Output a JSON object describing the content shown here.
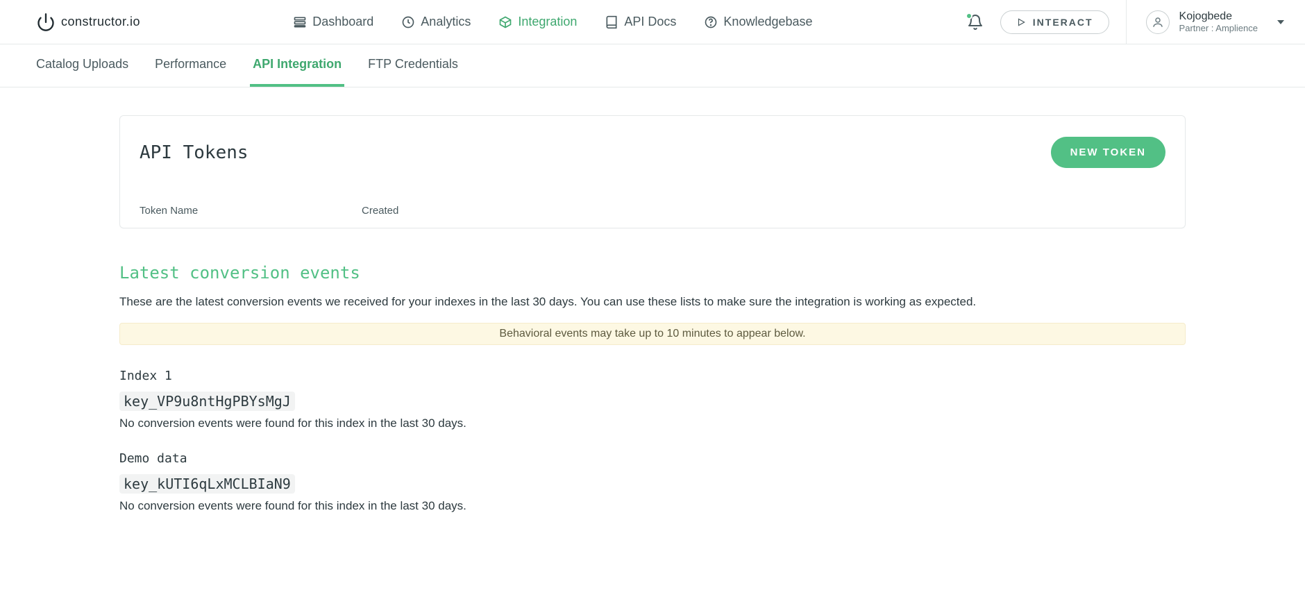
{
  "brand": {
    "wordmark": "constructor.io"
  },
  "nav": {
    "dashboard": "Dashboard",
    "analytics": "Analytics",
    "integration": "Integration",
    "api_docs": "API Docs",
    "knowledgebase": "Knowledgebase"
  },
  "interact_button": "INTERACT",
  "user": {
    "name": "Kojogbede",
    "subtitle": "Partner : Amplience"
  },
  "subnav": {
    "catalog_uploads": "Catalog Uploads",
    "performance": "Performance",
    "api_integration": "API Integration",
    "ftp_credentials": "FTP Credentials"
  },
  "tokens_card": {
    "title": "API Tokens",
    "new_button": "NEW TOKEN",
    "col_name": "Token Name",
    "col_created": "Created"
  },
  "events_section": {
    "title": "Latest conversion events",
    "description": "These are the latest conversion events we received for your indexes in the last 30 days. You can use these lists to make sure the integration is working as expected.",
    "behavior_note": "Behavioral events may take up to 10 minutes to appear below."
  },
  "indexes": {
    "0": {
      "name": "Index 1",
      "key": "key_VP9u8ntHgPBYsMgJ",
      "empty_msg": "No conversion events were found for this index in the last 30 days."
    },
    "1": {
      "name": "Demo data",
      "key": "key_kUTI6qLxMCLBIaN9",
      "empty_msg": "No conversion events were found for this index in the last 30 days."
    }
  }
}
